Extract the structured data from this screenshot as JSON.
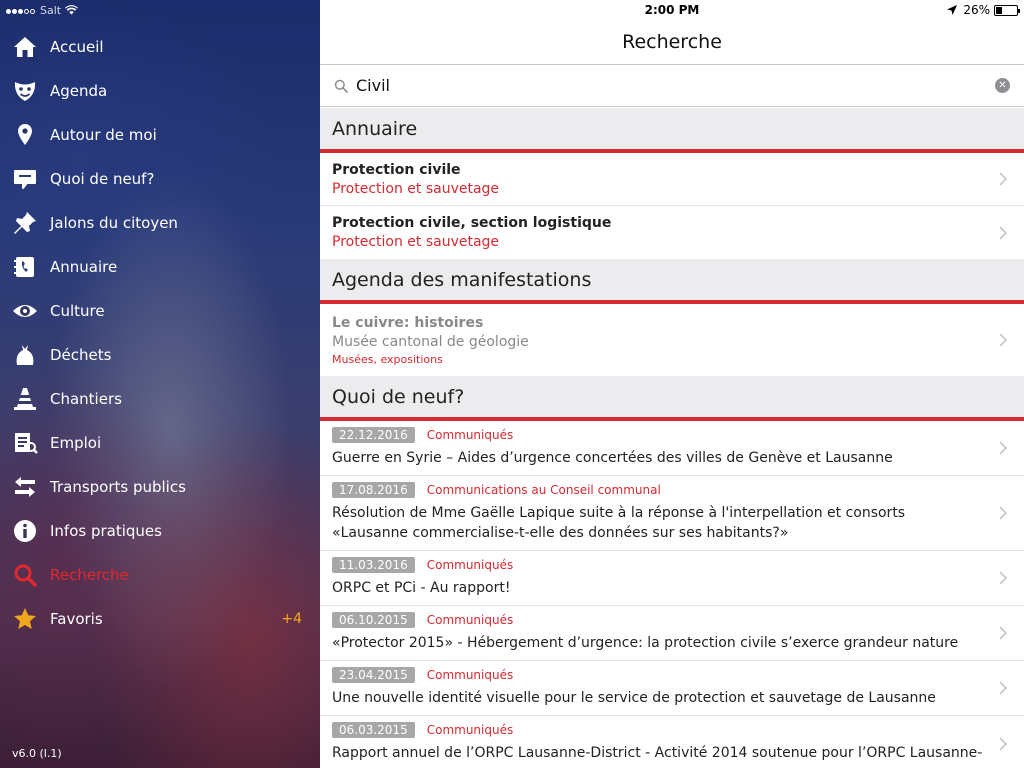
{
  "sidebar": {
    "status": {
      "carrier": "Salt"
    },
    "menu": [
      {
        "label": "Accueil",
        "icon": "home-icon"
      },
      {
        "label": "Agenda",
        "icon": "theater-mask-icon"
      },
      {
        "label": "Autour de moi",
        "icon": "location-pin-icon"
      },
      {
        "label": "Quoi de neuf?",
        "icon": "speech-bubble-icon"
      },
      {
        "label": "Jalons du citoyen",
        "icon": "pushpin-icon"
      },
      {
        "label": "Annuaire",
        "icon": "phone-book-icon"
      },
      {
        "label": "Culture",
        "icon": "eye-icon"
      },
      {
        "label": "Déchets",
        "icon": "trash-bag-icon"
      },
      {
        "label": "Chantiers",
        "icon": "traffic-cone-icon"
      },
      {
        "label": "Emploi",
        "icon": "job-document-icon"
      },
      {
        "label": "Transports publics",
        "icon": "transfer-arrows-icon"
      },
      {
        "label": "Infos pratiques",
        "icon": "info-icon"
      },
      {
        "label": "Recherche",
        "icon": "search-icon",
        "active": true
      },
      {
        "label": "Favoris",
        "icon": "star-icon",
        "badge": "+4"
      }
    ],
    "version": "v6.0 (l.1)"
  },
  "status": {
    "time": "2:00 PM",
    "battery": "26%"
  },
  "nav": {
    "title": "Recherche"
  },
  "search": {
    "value": "Civil"
  },
  "sections": {
    "annuaire": {
      "title": "Annuaire",
      "rows": [
        {
          "title": "Protection civile",
          "subtitle": "Protection et sauvetage"
        },
        {
          "title": "Protection civile, section logistique",
          "subtitle": "Protection et sauvetage"
        }
      ]
    },
    "agenda": {
      "title": "Agenda des manifestations",
      "rows": [
        {
          "title": "Le cuivre: histoires",
          "subtitle": "Musée cantonal de géologie",
          "category": "Musées, expositions"
        }
      ]
    },
    "news": {
      "title": "Quoi de neuf?",
      "rows": [
        {
          "date": "22.12.2016",
          "category": "Communiqués",
          "title": "Guerre en Syrie – Aides d’urgence concertées des villes de Genève et Lausanne"
        },
        {
          "date": "17.08.2016",
          "category": "Communications au Conseil communal",
          "title": "Résolution de Mme Gaëlle Lapique suite à la réponse à l'interpellation et consorts «Lausanne commercialise-t-elle des données sur ses habitants?»"
        },
        {
          "date": "11.03.2016",
          "category": "Communiqués",
          "title": "ORPC et PCi - Au rapport!"
        },
        {
          "date": "06.10.2015",
          "category": "Communiqués",
          "title": " «Protector 2015» - Hébergement d’urgence: la protection civile s’exerce grandeur nature"
        },
        {
          "date": "23.04.2015",
          "category": "Communiqués",
          "title": "Une nouvelle identité visuelle pour le service de protection et sauvetage de Lausanne"
        },
        {
          "date": "06.03.2015",
          "category": "Communiqués",
          "title": "Rapport annuel de l’ORPC Lausanne-District - Activité 2014 soutenue pour l’ORPC Lausanne-"
        }
      ]
    }
  },
  "colors": {
    "accent": "#d42a30",
    "favorite": "#f2a81c",
    "section_bg": "#ececee"
  }
}
